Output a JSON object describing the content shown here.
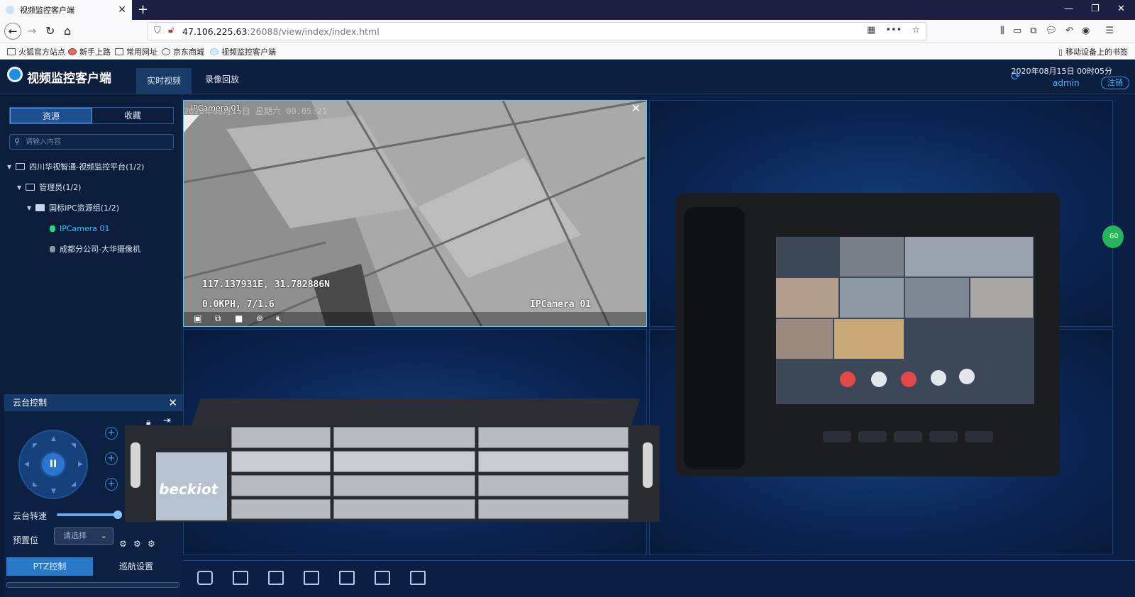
{
  "browser": {
    "tab_title": "视频监控客户端",
    "url_host": "47.106.225.63",
    "url_rest": ":26088/view/index/index.html",
    "bookmarks": [
      "火狐官方站点",
      "新手上路",
      "常用网址",
      "京东商城",
      "视频监控客户端"
    ],
    "mobile_bookmarks": "移动设备上的书签"
  },
  "app": {
    "title": "视频监控客户端",
    "tabs": [
      "实时视频",
      "录像回放"
    ],
    "datetime": "2020年08月15日 00时05分",
    "user": "admin",
    "logout": "注销"
  },
  "sidebar": {
    "seg_tabs": [
      "资源",
      "收藏"
    ],
    "search_placeholder": "请输入内容",
    "tree": [
      {
        "label": "四川华视智通-视频监控平台(1/2)"
      },
      {
        "label": "管理员(1/2)"
      },
      {
        "label": "国标IPC资源组(1/2)"
      },
      {
        "label": "IPCamera 01"
      },
      {
        "label": "成都分公司-大华摄像机"
      }
    ]
  },
  "ptz": {
    "title": "云台控制",
    "speed_label": "云台转速",
    "speed_value": 0.9,
    "preset_label": "预置位",
    "preset_placeholder": "请选择",
    "tabs": [
      "PTZ控制",
      "巡航设置"
    ]
  },
  "video": {
    "cam_name": "IPCamera 01",
    "osd_time": "2020年08月15日 星期六 00:05:21",
    "osd_coords": "117.137931E, 31.782886N",
    "osd_speed": "0.0KPH, 7/1.6",
    "osd_name": "IPCamera 01"
  },
  "overlay": {
    "rack_brand": "beckiot",
    "badge": "60"
  }
}
